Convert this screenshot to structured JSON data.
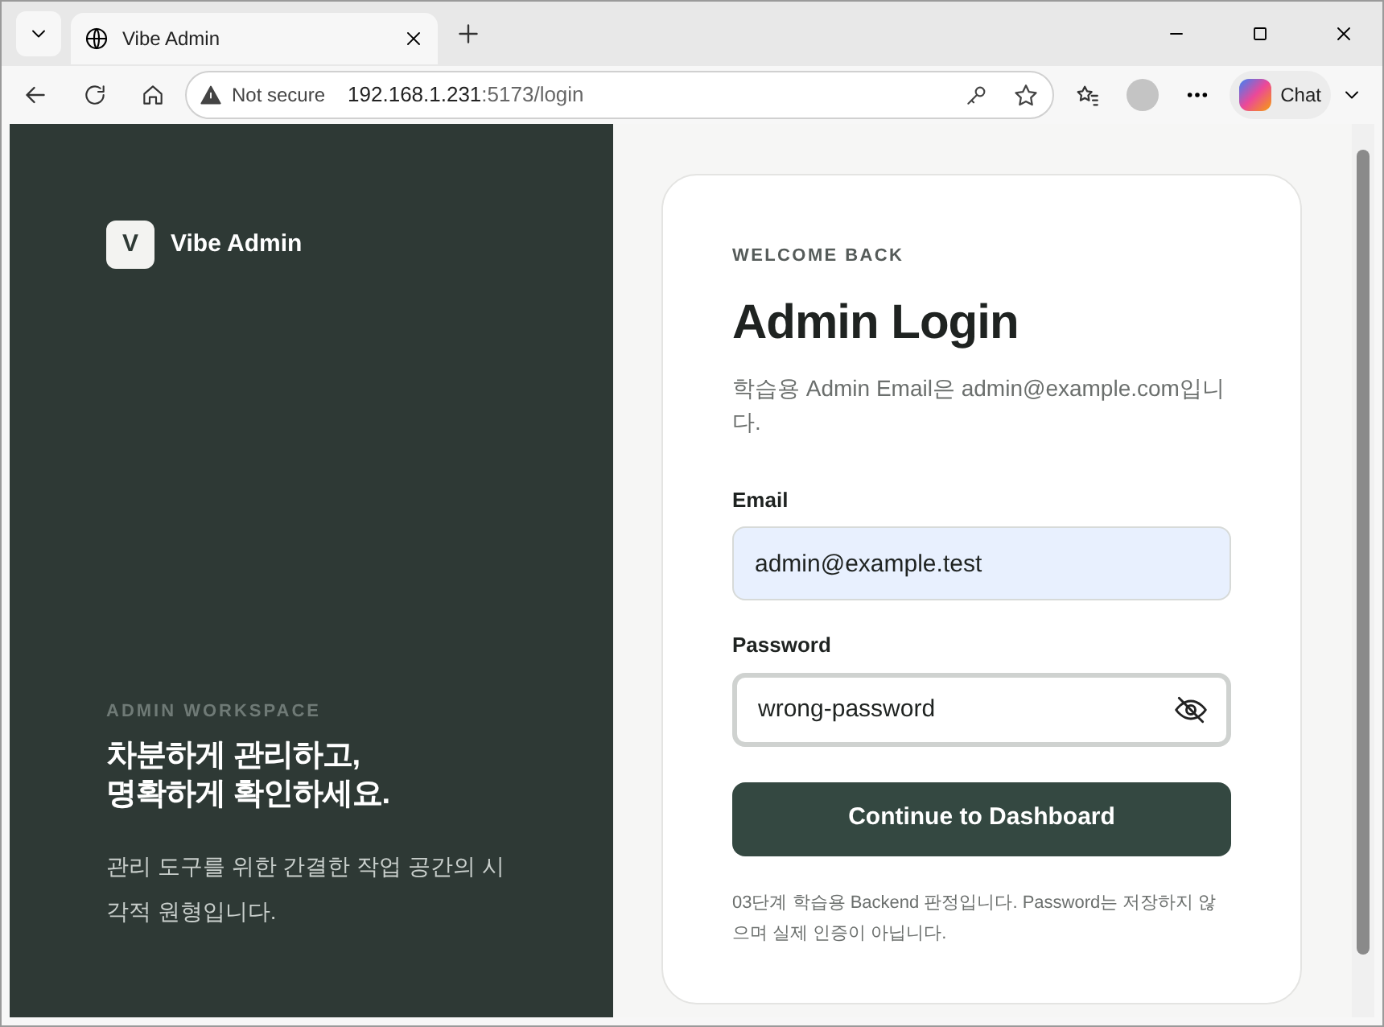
{
  "browser": {
    "tab_title": "Vibe Admin",
    "security": "Not secure",
    "url_host": "192.168.1.231",
    "url_rest": ":5173/login",
    "chat_label": "Chat"
  },
  "aside": {
    "logo_letter": "V",
    "brand": "Vibe Admin",
    "eyebrow": "ADMIN WORKSPACE",
    "headline": "차분하게 관리하고,\n명확하게 확인하세요.",
    "description": "관리 도구를 위한 간결한 작업 공간의 시각적 원형입니다."
  },
  "login": {
    "eyebrow": "WELCOME BACK",
    "title": "Admin Login",
    "subtitle": "학습용 Admin Email은 admin@example.com입니다.",
    "fields": [
      {
        "label": "Email",
        "value": "admin@example.test",
        "kind": "email",
        "autofilled": true,
        "focused": false
      },
      {
        "label": "Password",
        "value": "wrong-password",
        "kind": "password",
        "autofilled": false,
        "focused": true
      }
    ],
    "submit": "Continue to Dashboard",
    "note": "03단계 학습용 Backend 판정입니다. Password는 저장하지 않으며 실제 인증이 아닙니다."
  }
}
